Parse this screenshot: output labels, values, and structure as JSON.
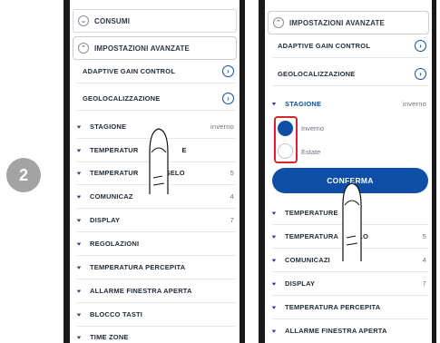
{
  "step": "2",
  "left": {
    "consumi": "CONSUMI",
    "impostazioni": "IMPOSTAZIONI AVANZATE",
    "rows": [
      {
        "label": "ADAPTIVE GAIN CONTROL",
        "value": ""
      },
      {
        "label": "GEOLOCALIZZAZIONE",
        "value": ""
      },
      {
        "label": "STAGIONE",
        "value": "inverno"
      },
      {
        "label": "TEMPERATUR",
        "value": "E"
      },
      {
        "label": "TEMPERATUR",
        "value": "SELO"
      },
      {
        "label": "COMUNICAZ",
        "value": ""
      },
      {
        "label": "DISPLAY",
        "value": "7"
      },
      {
        "label": "REGOLAZIONI",
        "value": ""
      },
      {
        "label": "TEMPERATURA PERCEPITA",
        "value": ""
      },
      {
        "label": "ALLARME FINESTRA APERTA",
        "value": ""
      },
      {
        "label": "BLOCCO TASTI",
        "value": ""
      },
      {
        "label": "TIME ZONE",
        "value": ""
      }
    ],
    "extra_values": {
      "temp2": "5",
      "comm": "4"
    }
  },
  "right": {
    "impostazioni": "IMPOSTAZIONI AVANZATE",
    "adaptive": "ADAPTIVE GAIN CONTROL",
    "geo": "GEOLOCALIZZAZIONE",
    "stagione": "STAGIONE",
    "stagione_value": "inverno",
    "radio_inverno": "Inverno",
    "radio_estate": "Estate",
    "confirm": "CONFERMA",
    "rows": [
      {
        "label": "TEMPERATURE",
        "value": ""
      },
      {
        "label": "TEMPERATURA",
        "value": "5"
      },
      {
        "label": "COMUNICAZI",
        "value": "4"
      },
      {
        "label": "DISPLAY",
        "value": "7"
      },
      {
        "label": "TEMPERATURA PERCEPITA",
        "value": ""
      },
      {
        "label": "ALLARME FINESTRA APERTA",
        "value": ""
      }
    ],
    "lo_fragment": "LO"
  },
  "colors": {
    "accent": "#0d4ea6",
    "highlight": "#d62828",
    "phone": "#1a1a1a"
  }
}
